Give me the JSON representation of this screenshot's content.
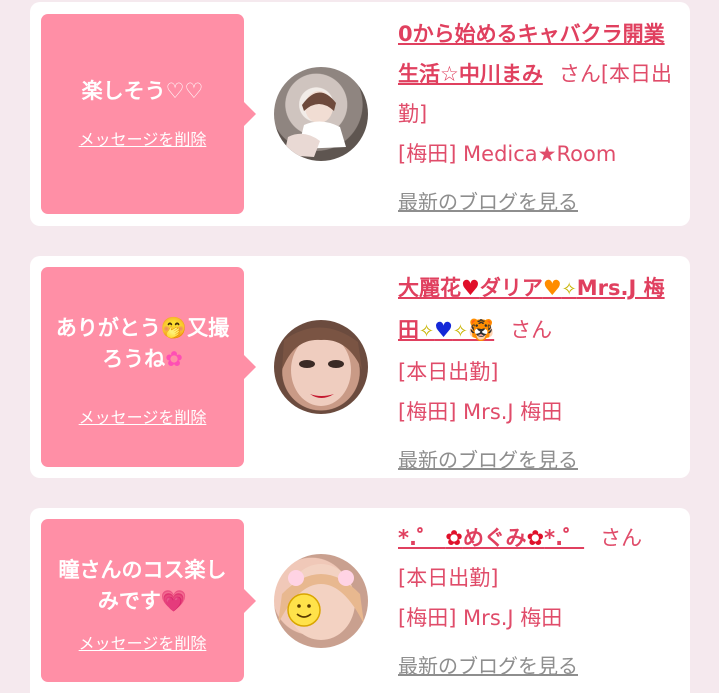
{
  "delete_label": "メッセージを削除",
  "blog_label": "最新のブログを見る",
  "san_label": "さん",
  "cards": [
    {
      "message": "楽しそう♡♡",
      "name": "0から始めるキャバクラ開業生活☆中川まみ",
      "suffix": "さん[本日出勤]",
      "location": "[梅田] Medica★Room"
    },
    {
      "message_text": "ありがとう",
      "message_emoji_1": "🤭",
      "message_text_2": "又撮ろうね",
      "message_emoji_2": "✿",
      "name_parts": [
        "大麗花",
        "♥",
        "ダリア",
        "♥",
        "✧",
        "Mrs.J 梅田",
        "✧",
        "♥",
        "✧",
        "🐯"
      ],
      "suffix": "さん",
      "status": "[本日出勤]",
      "location": "[梅田] Mrs.J 梅田"
    },
    {
      "message_text": "瞳さんのコス楽しみです",
      "message_emoji": "💗",
      "name_parts": [
        "*.゜",
        "✿",
        "めぐみ",
        "✿",
        "*.゜"
      ],
      "suffix": "さん",
      "status": "[本日出勤]",
      "location": "[梅田] Mrs.J 梅田"
    }
  ],
  "colors": {
    "accent_pink": "#ff8fa6",
    "link_red": "#e0405f",
    "text_red": "#e04c6a",
    "blog_gray": "#8e8e8e",
    "background": "#f5e9ee"
  }
}
